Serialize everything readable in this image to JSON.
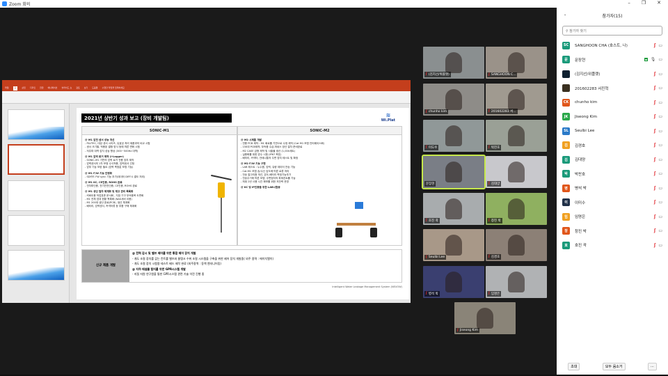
{
  "window": {
    "title": "Zoom 회의"
  },
  "presentation": {
    "ribbon_tabs": [
      "파일",
      "홈",
      "삽입",
      "디자인",
      "전환",
      "애니메이션",
      "슬라이드 쇼",
      "검토",
      "보기",
      "도움말",
      "수행할 작업을 입력하세요"
    ],
    "active_tab": "홈",
    "slide": {
      "title": "2021년 상반기 성과 보고 (장비 개발팀)",
      "logo": "Wi.Plat",
      "m1": {
        "header": "SONIC-M1",
        "sections": [
          {
            "h": "@ M1 압전 센서 성능 개선",
            "items": [
              "- PLUTEC, 대성 센서 시리즈, 유효성 처리 제품과의 비교 시험",
              "- 센서 크기별, 적용된 결함 방식 등에 따른 변화 시험",
              "- 저주파 대역 감지 성능 향상 (300~500Hz 대역)"
            ]
          },
          {
            "h": "@ M1 압력 로거 제작 (i-Logger)",
            "items": [
              "- SONIC-M1 기반의 압력 로거 전용 장치 제작",
              "- 압력센서의 1차 보정 수식적용, 압력센서 선정",
              "- 압부 기능 보완 필요 (압력 측정값 보정 기능)"
            ]
          },
          {
            "h": "@ M1 F/W 기능 안정화",
            "items": [
              "- SD카드 FW sync 기능 추가(데이터 DIFF시 결도 처리)"
            ]
          },
          {
            "h": "@ M1 KC, CE인증, ROHS 완료",
            "items": [
              "- 전자파인증, 전기안전인증, CE인증, ROHS 완료"
            ]
          },
          {
            "h": "@ M1 생산 절차 체계화 및 재고 관리 목록화",
            "items": [
              "- 커버이용 작업표준 문서화 , 지장 기구 부속품목 도면화",
              "- M1 전체 업대 현황 목록화 (NAS서버 이용)",
              "- M1 200대 생산 완료(PCB), 생산 체계화",
              "- 배터리, 압력센서, 커넥터류 등 부품 구매 체계화"
            ]
          }
        ]
      },
      "m2": {
        "header": "SONIC-M2",
        "sections": [
          {
            "h": "@ M2 시제품 개발",
            "items": [
              "- 전용 PCB 제작 : M1 회로를 기반으로 수정 제작 (Cat M1 모뎀 인터페이스화)",
              "- 150대 PCB제작, 부속품 수급,하네스 양산 절차 준비완료",
              "- M2 CASE 금형 제작 및 사출물 생산 (1,000세트)",
              "- 실용화를 위한 방수 시험 (IP67 목표)",
              "- 배터리, 커넥터, 안테나통의 주변 장치 테스트 및 확정"
            ]
          },
          {
            "h": "@ M2 F/W 기능 구현",
            "items": [
              "- LAB 테스트 : 누수음, 압력, 유량 데이터 전송 기능",
              "- Cat.M1 모뎀 송/수신 감도에 따른 로류 처리",
              "- 전송 알고리즘 개선, 온도,배터리 측정기능추가",
              "- 전송주기에 따른 모뎀, 주변장치의 파워컨트롤 기능",
              "- 최대 2년 사용 시간 확보를 위한 저전력 운영"
            ]
          },
          {
            "h": "@ KC 및 IP인증을 위한 LAB시험중",
            "items": []
          }
        ]
      },
      "new_dev": {
        "label": "신규 제품 개발",
        "lines": [
          "@ 전력 감시 및 밸브 제어를 위한 통합 제어 장치 개발",
          "- 개도 조절 장치를 갖는 컨트롤 밸브와 물탱크 수위 조절 시스템을 구축을 위한 제어 장치 개발중( 외주 용역 : 에이치엘이)",
          "- 개도 조절 장치 시험용 테스트 베드 제작 완료 (외주용역 : 동액 엔지니어링)",
          "@ 지하 매설물 탐지를 위한 GPR시스템 개발",
          "- 지질 자원 연구원을 통한 GPR시스템 관련 기술 이전 진행 중"
        ]
      },
      "footer": "Intelligent Water Leakage Management System (NEUOW)"
    }
  },
  "gallery": [
    {
      "name": "(김지선/위플랫)",
      "muted": true,
      "bg": "#8a8f90"
    },
    {
      "name": "SANGHOON C...",
      "muted": true,
      "bg": "#9a9289"
    },
    {
      "name": "chunho kim",
      "muted": true,
      "bg": "#8e8c88"
    },
    {
      "name": "201602283 서...",
      "muted": true,
      "bg": "#a09a90"
    },
    {
      "name": "이도수",
      "muted": true,
      "bg": "#909898"
    },
    {
      "name": "박찬호",
      "muted": true,
      "bg": "#9aa096"
    },
    {
      "name": "문장현",
      "muted": false,
      "active": true,
      "bg": "#7a7e86"
    },
    {
      "name": "김대양",
      "muted": true,
      "bg": "#c8c8cc"
    },
    {
      "name": "호진 곽",
      "muted": true,
      "bg": "#a8acae"
    },
    {
      "name": "창진 박",
      "muted": true,
      "bg": "#8fb060"
    },
    {
      "name": "Seulbi Lee",
      "muted": true,
      "bg": "#a89888"
    },
    {
      "name": "김경호",
      "muted": true,
      "bg": "#8c8076"
    },
    {
      "name": "병석 박",
      "muted": true,
      "bg": "#3a3f70"
    },
    {
      "name": "임명은",
      "muted": true,
      "bg": "#b0b2b4"
    },
    {
      "name": "Jiseong Kim",
      "muted": true,
      "bg": "#8a8478"
    }
  ],
  "participants": {
    "title": "참가자(15)",
    "search_placeholder": "참가자 찾기",
    "list": [
      {
        "initials": "SC",
        "name": "SANGHOON CHA (호스트, 나)",
        "color": "#1a9a7a",
        "mic": "muted"
      },
      {
        "initials": "문",
        "name": "문장현",
        "color": "#1a9a7a",
        "mic": "on"
      },
      {
        "initials": "",
        "name": "(김지선/위플랫)",
        "color": "#0e2030",
        "mic": "muted"
      },
      {
        "initials": "",
        "name": "201602283 서진혁",
        "color": "#3a3020",
        "mic": "muted"
      },
      {
        "initials": "CK",
        "name": "chunho kim",
        "color": "#e0561a",
        "mic": "muted"
      },
      {
        "initials": "JK",
        "name": "Jiseong Kim",
        "color": "#2aa84a",
        "mic": "muted"
      },
      {
        "initials": "SL",
        "name": "Seulbi Lee",
        "color": "#2a7ac8",
        "mic": "muted"
      },
      {
        "initials": "김",
        "name": "김경호",
        "color": "#f0a020",
        "mic": "muted"
      },
      {
        "initials": "김",
        "name": "김대양",
        "color": "#1a9a7a",
        "mic": "muted"
      },
      {
        "initials": "박",
        "name": "박찬호",
        "color": "#1a9a7a",
        "mic": "muted"
      },
      {
        "initials": "병",
        "name": "병석 박",
        "color": "#e0561a",
        "mic": "muted"
      },
      {
        "initials": "이",
        "name": "이미수",
        "color": "#203048",
        "mic": "muted"
      },
      {
        "initials": "임",
        "name": "임명은",
        "color": "#f0a020",
        "mic": "muted"
      },
      {
        "initials": "창",
        "name": "창진 박",
        "color": "#e0561a",
        "mic": "muted"
      },
      {
        "initials": "호",
        "name": "호진 곽",
        "color": "#1a9a7a",
        "mic": "muted"
      }
    ],
    "invite_label": "초대",
    "mute_all_label": "모두 음소거",
    "more_label": "..."
  }
}
